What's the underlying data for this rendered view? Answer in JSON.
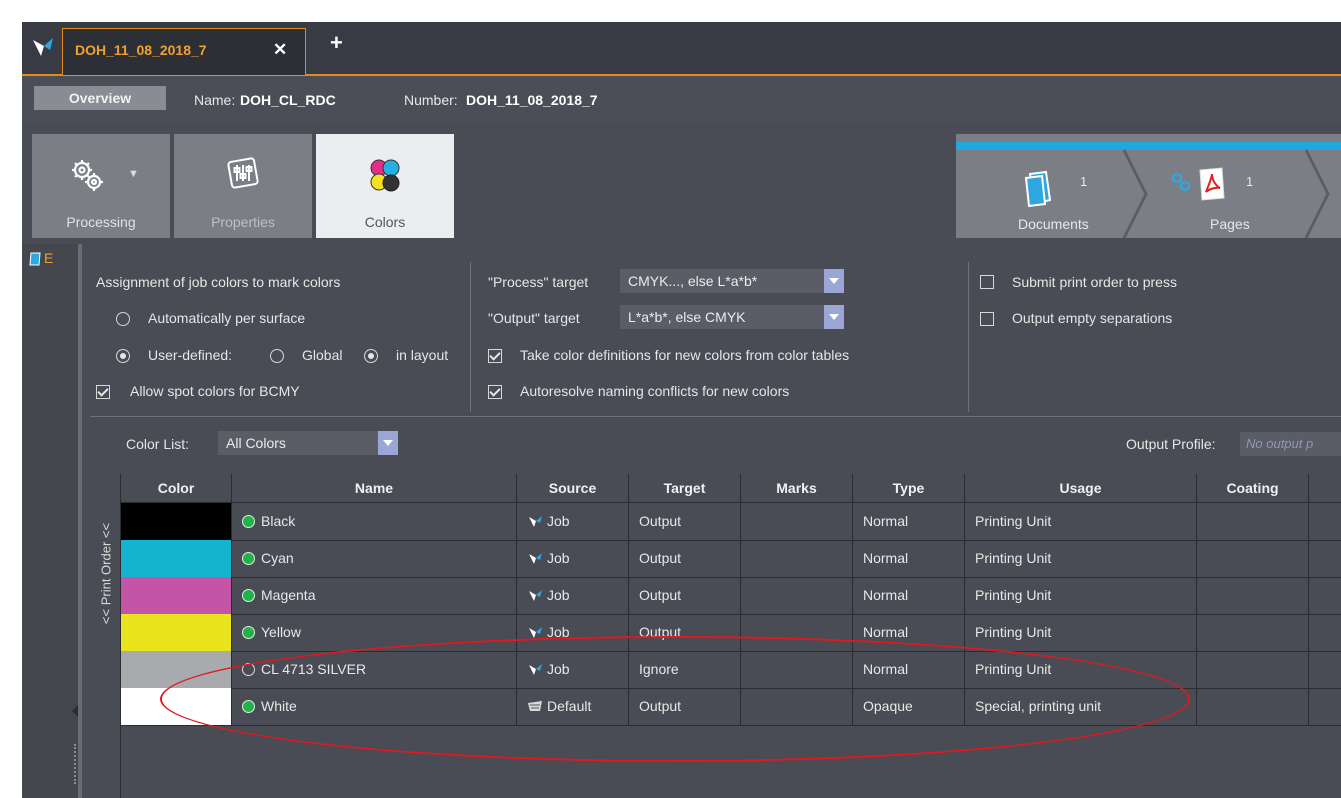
{
  "tab": {
    "title": "DOH_11_08_2018_7",
    "close": "✕",
    "add": "+"
  },
  "overview": {
    "button": "Overview",
    "name_label": "Name:",
    "name_value": "DOH_CL_RDC",
    "number_label": "Number:",
    "number_value": "DOH_11_08_2018_7"
  },
  "modules": [
    {
      "label": "Processing",
      "icon": "gears-icon"
    },
    {
      "label": "Properties",
      "icon": "sliders-icon"
    },
    {
      "label": "Colors",
      "icon": "colors-icon"
    }
  ],
  "workflow": {
    "documents": {
      "label": "Documents",
      "count": "1"
    },
    "pages": {
      "label": "Pages",
      "count": "1"
    }
  },
  "sidebar": {
    "item": "E"
  },
  "settings": {
    "assignment_title": "Assignment of job colors to mark colors",
    "auto_per_surface": "Automatically per surface",
    "user_defined": "User-defined:",
    "global": "Global",
    "in_layout": "in layout",
    "allow_spot": "Allow spot colors for BCMY",
    "process_target_label": "\"Process\" target",
    "process_target_value": "CMYK..., else L*a*b*",
    "output_target_label": "\"Output\" target",
    "output_target_value": "L*a*b*, else CMYK",
    "take_color_defs": "Take color definitions for new colors from color tables",
    "autoresolve": "Autoresolve naming conflicts for new colors",
    "submit_print_order": "Submit print order to press",
    "output_empty_separations": "Output empty separations"
  },
  "color_list": {
    "label": "Color List:",
    "value": "All Colors"
  },
  "output_profile": {
    "label": "Output Profile:",
    "placeholder": "No output p"
  },
  "print_order_label": "<< Print Order <<",
  "table": {
    "headers": [
      "Color",
      "Name",
      "Source",
      "Target",
      "Marks",
      "Type",
      "Usage",
      "Coating"
    ],
    "rows": [
      {
        "swatch": "#000000",
        "status": "green",
        "name": "Black",
        "source": "Job",
        "target": "Output",
        "marks": "",
        "type": "Normal",
        "usage": "Printing Unit",
        "coating": ""
      },
      {
        "swatch": "#14b4d0",
        "status": "green",
        "name": "Cyan",
        "source": "Job",
        "target": "Output",
        "marks": "",
        "type": "Normal",
        "usage": "Printing Unit",
        "coating": ""
      },
      {
        "swatch": "#c455a6",
        "status": "green",
        "name": "Magenta",
        "source": "Job",
        "target": "Output",
        "marks": "",
        "type": "Normal",
        "usage": "Printing Unit",
        "coating": ""
      },
      {
        "swatch": "#e9e31c",
        "status": "green",
        "name": "Yellow",
        "source": "Job",
        "target": "Output",
        "marks": "",
        "type": "Normal",
        "usage": "Printing Unit",
        "coating": ""
      },
      {
        "swatch": "#a9aaad",
        "status": "empty",
        "name": "CL 4713 SILVER",
        "source": "Job",
        "target": "Ignore",
        "marks": "",
        "type": "Normal",
        "usage": "Printing Unit",
        "coating": ""
      },
      {
        "swatch": "#ffffff",
        "status": "green",
        "name": "White",
        "source": "Default",
        "target": "Output",
        "marks": "",
        "type": "Opaque",
        "usage": "Special, printing unit",
        "coating": ""
      }
    ]
  },
  "colors": {
    "accent": "#e6891f",
    "workflow_stripe": "#1fa9dc",
    "highlight_ellipse": "#e0191f"
  }
}
